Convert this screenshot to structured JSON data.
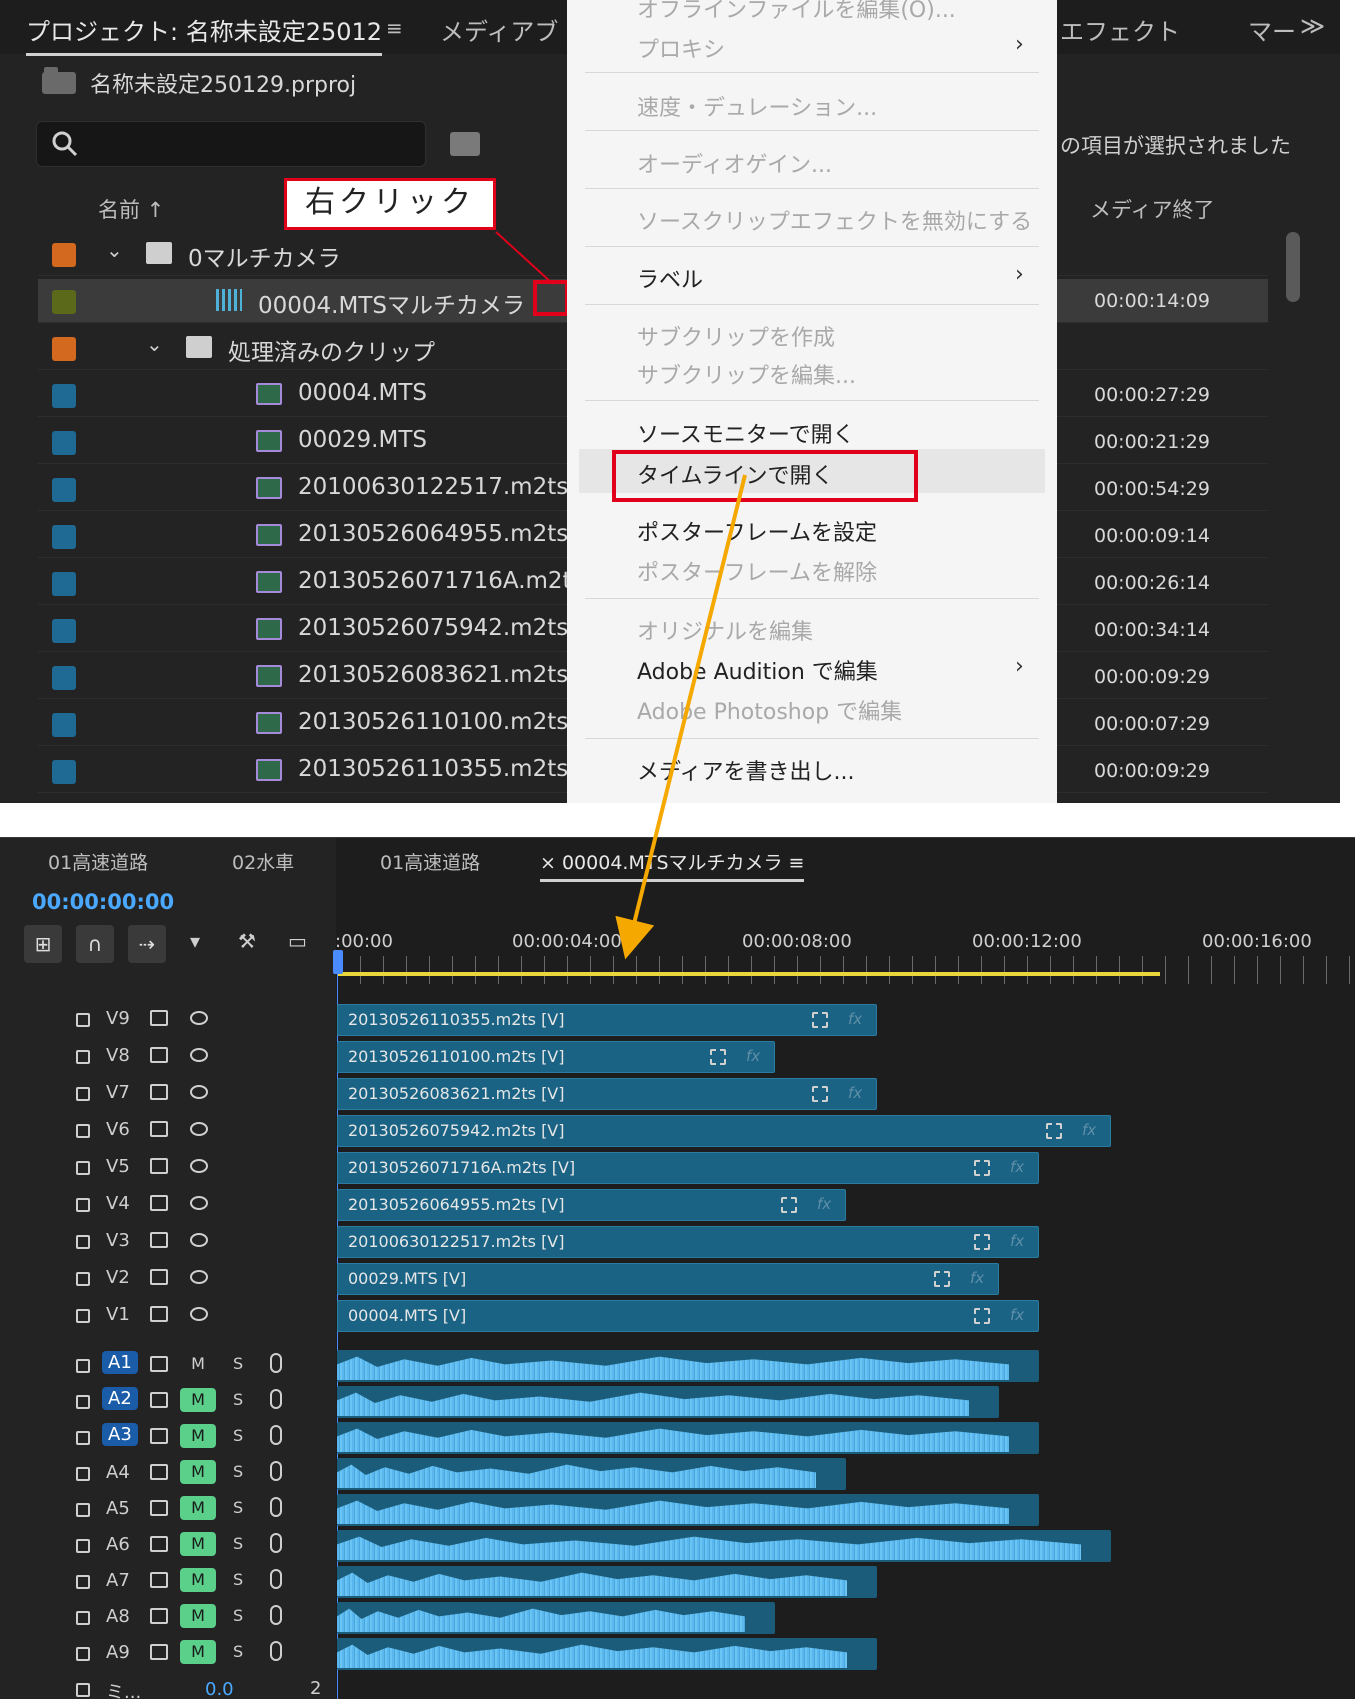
{
  "project_panel": {
    "tabs": [
      "プロジェクト: 名称未設定25012",
      "メディアブ",
      "エフェクト",
      "マー",
      "≫"
    ],
    "project_file": "名称未設定250129.prproj",
    "search_placeholder": "",
    "selected_message": "の項目が選択されました",
    "column_name": "名前 ↑",
    "column_end": "メディア終了",
    "rows": [
      {
        "label": "0マルチカメラ",
        "duration": "",
        "swatch": "#d2691e",
        "type": "folder",
        "level": 0
      },
      {
        "label": "00004.MTSマルチカメラ",
        "duration": "00:00:14:09",
        "swatch": "#5a6a1a",
        "type": "multicam",
        "level": 1,
        "selected": true
      },
      {
        "label": "処理済みのクリップ",
        "duration": "",
        "swatch": "#d2691e",
        "type": "folder",
        "level": 1
      },
      {
        "label": "00004.MTS",
        "duration": "00:00:27:29",
        "swatch": "#1e6a94",
        "type": "clip",
        "level": 2
      },
      {
        "label": "00029.MTS",
        "duration": "00:00:21:29",
        "swatch": "#1e6a94",
        "type": "clip",
        "level": 2
      },
      {
        "label": "20100630122517.m2ts",
        "duration": "00:00:54:29",
        "swatch": "#1e6a94",
        "type": "clip",
        "level": 2
      },
      {
        "label": "20130526064955.m2ts",
        "duration": "00:00:09:14",
        "swatch": "#1e6a94",
        "type": "clip",
        "level": 2
      },
      {
        "label": "20130526071716A.m2ts",
        "duration": "00:00:26:14",
        "swatch": "#1e6a94",
        "type": "clip",
        "level": 2
      },
      {
        "label": "20130526075942.m2ts",
        "duration": "00:00:34:14",
        "swatch": "#1e6a94",
        "type": "clip",
        "level": 2
      },
      {
        "label": "20130526083621.m2ts",
        "duration": "00:00:09:29",
        "swatch": "#1e6a94",
        "type": "clip",
        "level": 2
      },
      {
        "label": "20130526110100.m2ts",
        "duration": "00:00:07:29",
        "swatch": "#1e6a94",
        "type": "clip",
        "level": 2
      },
      {
        "label": "20130526110355.m2ts",
        "duration": "00:00:09:29",
        "swatch": "#1e6a94",
        "type": "clip",
        "level": 2
      }
    ]
  },
  "annotation": {
    "callout": "右クリック"
  },
  "context_menu": {
    "items": [
      {
        "label": "オフラインファイルを編集(O)...",
        "disabled": true,
        "arrow": false
      },
      {
        "label": "プロキシ",
        "disabled": true,
        "arrow": true
      },
      {
        "label": "速度・デュレーション...",
        "disabled": true,
        "arrow": false
      },
      {
        "label": "オーディオゲイン...",
        "disabled": true,
        "arrow": false
      },
      {
        "label": "ソースクリップエフェクトを無効にする",
        "disabled": true,
        "arrow": false
      },
      {
        "label": "ラベル",
        "disabled": false,
        "arrow": true
      },
      {
        "label": "サブクリップを作成",
        "disabled": true,
        "arrow": false
      },
      {
        "label": "サブクリップを編集...",
        "disabled": true,
        "arrow": false
      },
      {
        "label": "ソースモニターで開く",
        "disabled": false,
        "arrow": false
      },
      {
        "label": "タイムラインで開く",
        "disabled": false,
        "arrow": false,
        "highlighted": true
      },
      {
        "label": "ポスターフレームを設定",
        "disabled": false,
        "arrow": false
      },
      {
        "label": "ポスターフレームを解除",
        "disabled": true,
        "arrow": false
      },
      {
        "label": "オリジナルを編集",
        "disabled": true,
        "arrow": false
      },
      {
        "label": "Adobe Audition で編集",
        "disabled": false,
        "arrow": true
      },
      {
        "label": "Adobe Photoshop で編集",
        "disabled": true,
        "arrow": false
      },
      {
        "label": "メディアを書き出し...",
        "disabled": false,
        "arrow": false
      }
    ]
  },
  "timeline": {
    "tabs": [
      "01高速道路",
      "02水車",
      "01高速道路",
      "× 00004.MTSマルチカメラ ≡"
    ],
    "timecode": "00:00:00:00",
    "ruler_labels": [
      ":00:00",
      "00:00:04:00",
      "00:00:08:00",
      "00:00:12:00",
      "00:00:16:00"
    ],
    "video_tracks": [
      {
        "name": "V9",
        "clip": "20130526110355.m2ts [V]",
        "length": 0.53
      },
      {
        "name": "V8",
        "clip": "20130526110100.m2ts [V]",
        "length": 0.43
      },
      {
        "name": "V7",
        "clip": "20130526083621.m2ts [V]",
        "length": 0.53
      },
      {
        "name": "V6",
        "clip": "20130526075942.m2ts [V]",
        "length": 0.76
      },
      {
        "name": "V5",
        "clip": "20130526071716A.m2ts [V]",
        "length": 0.69
      },
      {
        "name": "V4",
        "clip": "20130526064955.m2ts [V]",
        "length": 0.5
      },
      {
        "name": "V3",
        "clip": "20100630122517.m2ts [V]",
        "length": 0.69
      },
      {
        "name": "V2",
        "clip": "00029.MTS [V]",
        "length": 0.65
      },
      {
        "name": "V1",
        "clip": "00004.MTS [V]",
        "length": 0.69
      }
    ],
    "audio_tracks": [
      {
        "name": "A1",
        "target": true,
        "mute": false,
        "length": 0.69
      },
      {
        "name": "A2",
        "target": true,
        "mute": true,
        "length": 0.65
      },
      {
        "name": "A3",
        "target": true,
        "mute": true,
        "length": 0.69
      },
      {
        "name": "A4",
        "target": false,
        "mute": true,
        "length": 0.5
      },
      {
        "name": "A5",
        "target": false,
        "mute": true,
        "length": 0.69
      },
      {
        "name": "A6",
        "target": false,
        "mute": true,
        "length": 0.76
      },
      {
        "name": "A7",
        "target": false,
        "mute": true,
        "length": 0.53
      },
      {
        "name": "A8",
        "target": false,
        "mute": true,
        "length": 0.43
      },
      {
        "name": "A9",
        "target": false,
        "mute": true,
        "length": 0.53
      }
    ],
    "mix": {
      "name": "ミ...",
      "value": "0.0",
      "suffix": "2"
    },
    "m_label": "M",
    "s_label": "S",
    "fx_label": "fx"
  }
}
